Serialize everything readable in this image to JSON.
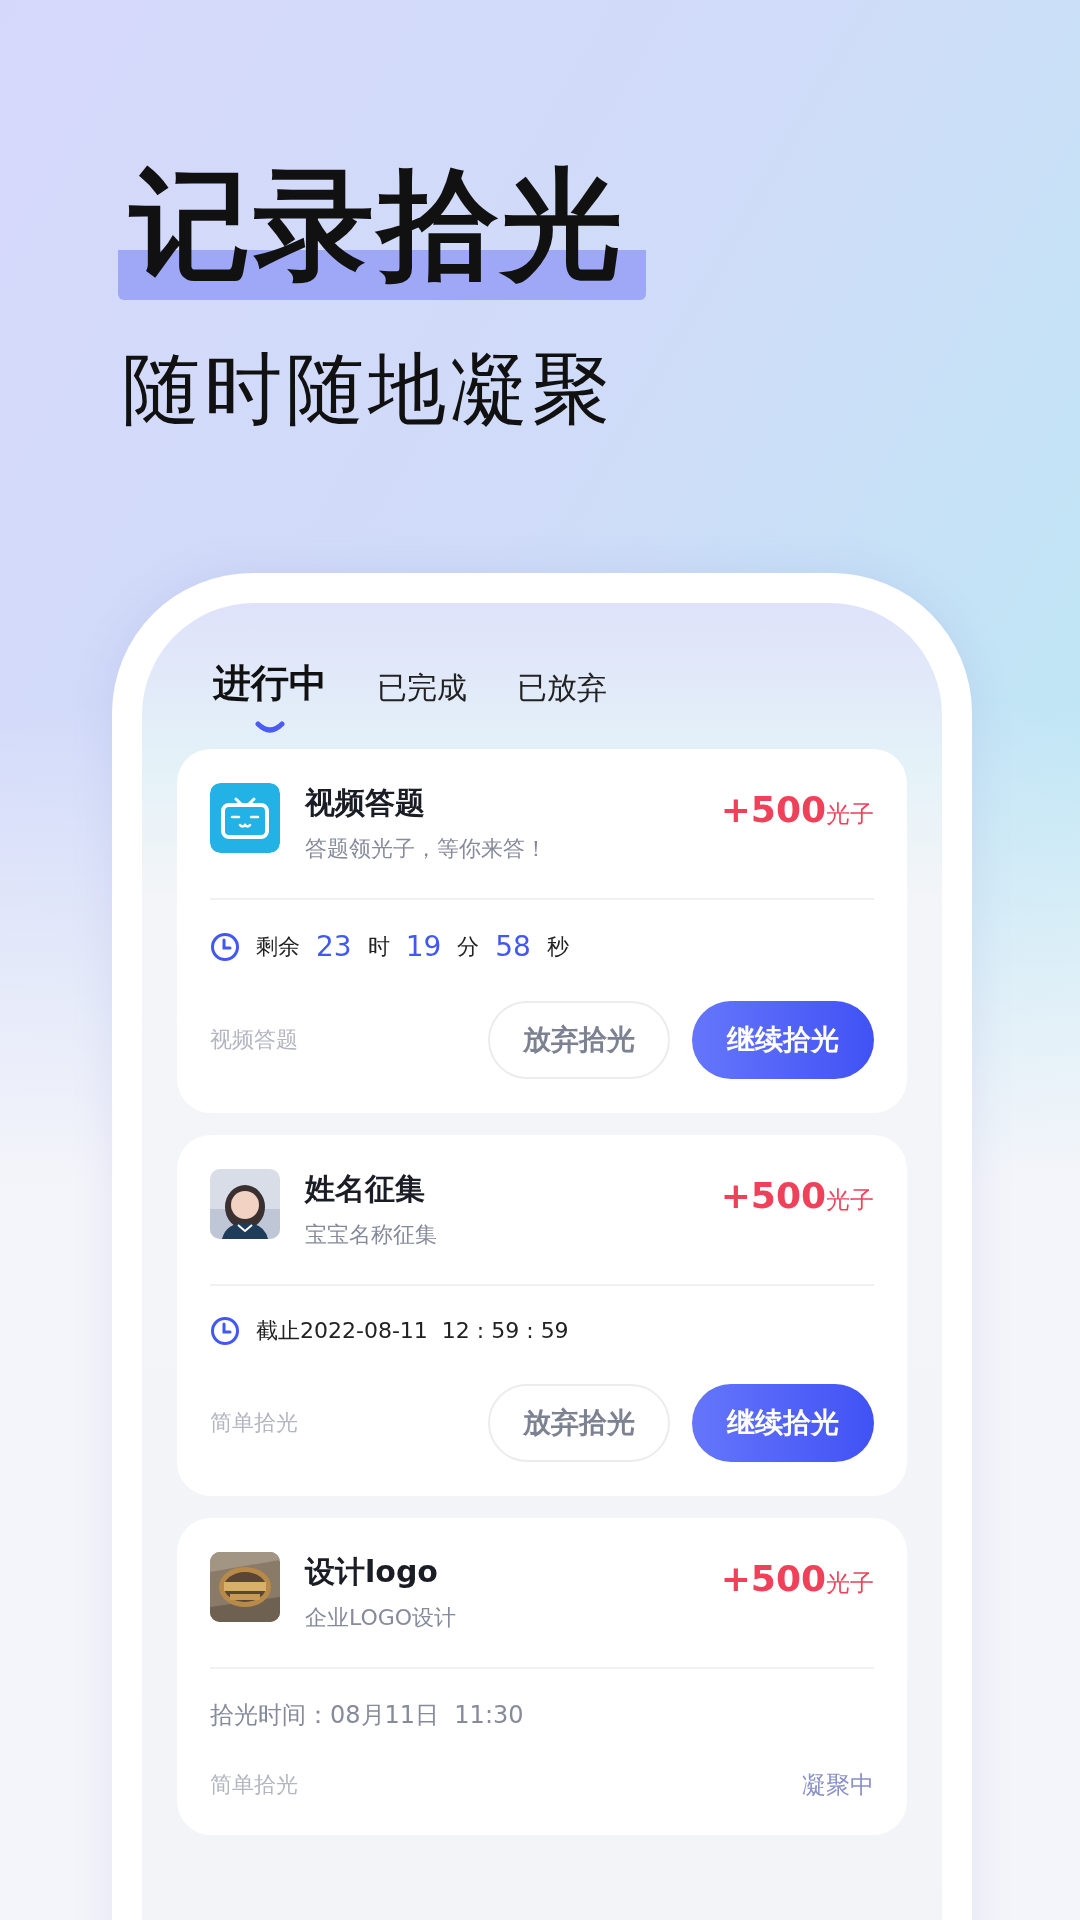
{
  "headline": "记录拾光",
  "subheadline": "随时随地凝聚",
  "tabs": [
    {
      "label": "进行中",
      "selected": true
    },
    {
      "label": "已完成",
      "selected": false
    },
    {
      "label": "已放弃",
      "selected": false
    }
  ],
  "tasks": [
    {
      "thumb": {
        "kind": "icon"
      },
      "title": "视频答题",
      "subtitle": "答题领光子，等你来答！",
      "reward": "+500",
      "reward_unit": "光子",
      "kind": "countdown",
      "countdown": [
        {
          "kind": "unit",
          "text": "剩余"
        },
        {
          "kind": "number",
          "text": "23"
        },
        {
          "kind": "unit",
          "text": "时"
        },
        {
          "kind": "number",
          "text": "19"
        },
        {
          "kind": "unit",
          "text": "分"
        },
        {
          "kind": "number",
          "text": "58"
        },
        {
          "kind": "unit",
          "text": "秒"
        }
      ],
      "category": "视频答题",
      "buttons": [
        {
          "label": "放弃拾光",
          "kind": "secondary"
        },
        {
          "label": "继续拾光",
          "kind": "primary"
        }
      ]
    },
    {
      "thumb": {
        "kind": "picture"
      },
      "title": "姓名征集",
      "subtitle": "宝宝名称征集",
      "reward": "+500",
      "reward_unit": "光子",
      "kind": "deadline",
      "deadline": "截止2022-08-11  12 : 59 : 59",
      "category": "简单拾光",
      "buttons": [
        {
          "label": "放弃拾光",
          "kind": "secondary"
        },
        {
          "label": "继续拾光",
          "kind": "primary"
        }
      ]
    },
    {
      "thumb": {
        "kind": "picture"
      },
      "title": "设计logo",
      "subtitle": "企业LOGO设计",
      "reward": "+500",
      "reward_unit": "光子",
      "kind": "time",
      "time": "拾光时间：08月11日  11:30",
      "category": "简单拾光",
      "status": "凝聚中"
    }
  ]
}
